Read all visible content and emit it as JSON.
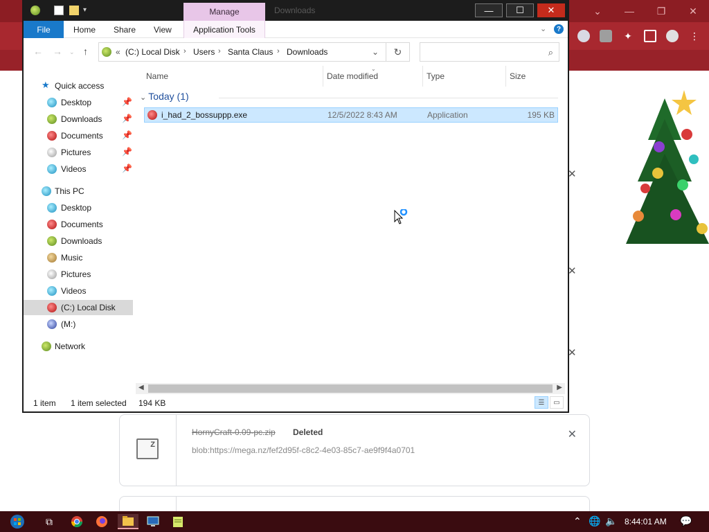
{
  "explorer": {
    "title": "Downloads",
    "manage_label": "Manage",
    "ribbon": {
      "file": "File",
      "home": "Home",
      "share": "Share",
      "view": "View",
      "app_tools": "Application Tools",
      "help": "?"
    },
    "address": {
      "overflow": "«",
      "crumbs": [
        "(C:) Local Disk",
        "Users",
        "Santa Claus",
        "Downloads"
      ]
    },
    "search_placeholder": "",
    "nav": {
      "quick_access": "Quick access",
      "quick_items": [
        "Desktop",
        "Downloads",
        "Documents",
        "Pictures",
        "Videos"
      ],
      "this_pc": "This PC",
      "pc_items": [
        "Desktop",
        "Documents",
        "Downloads",
        "Music",
        "Pictures",
        "Videos",
        "(C:) Local Disk",
        "(M:)"
      ],
      "network": "Network"
    },
    "columns": {
      "name": "Name",
      "date": "Date modified",
      "type": "Type",
      "size": "Size"
    },
    "group": "Today (1)",
    "file": {
      "name": "i_had_2_bossuppp.exe",
      "date": "12/5/2022 8:43 AM",
      "type": "Application",
      "size": "195 KB"
    },
    "status": {
      "count": "1 item",
      "selected": "1 item selected",
      "size": "194 KB"
    }
  },
  "browser": {
    "downloads": [
      {
        "name": "HornyCraft-0.09-pc.zip",
        "status": "Deleted",
        "url": "blob:https://mega.nz/fef2d95f-c8c2-4e03-85c7-ae9f9f4a0701"
      }
    ]
  },
  "taskbar": {
    "clock": "8:44:01 AM"
  },
  "colors": {
    "file_tab": "#1979ca",
    "manage_tab": "#e8c6e8",
    "selection": "#cce8ff",
    "browser_frame": "#8c1d23",
    "taskbar": "#3a0c10"
  }
}
